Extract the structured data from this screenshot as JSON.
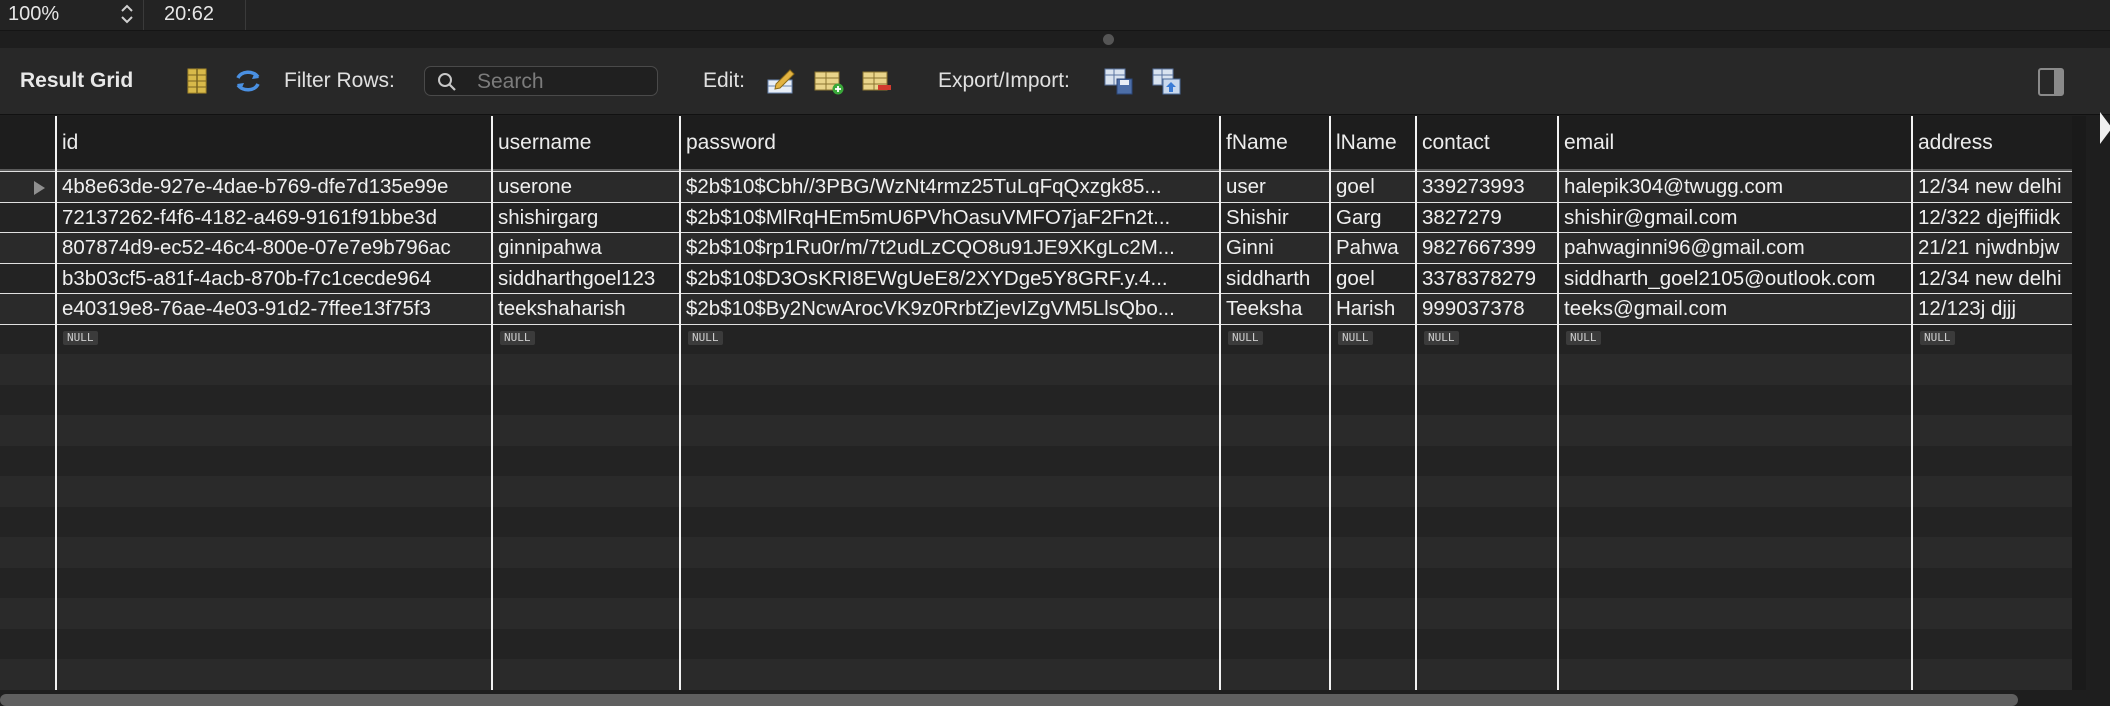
{
  "status": {
    "zoom": "100%",
    "cursor_position": "20:62"
  },
  "toolbar": {
    "result_grid": "Result Grid",
    "filter_rows": "Filter Rows:",
    "search_placeholder": "Search",
    "edit": "Edit:",
    "export_import": "Export/Import:"
  },
  "colors": {
    "background": "#1e1e1e",
    "row_odd": "#2a2a2a",
    "row_even": "#232323",
    "grid_line": "#f2f2f2"
  },
  "columns": [
    "id",
    "username",
    "password",
    "fName",
    "lName",
    "contact",
    "email",
    "address"
  ],
  "rows": [
    [
      "4b8e63de-927e-4dae-b769-dfe7d135e99e",
      "userone",
      "$2b$10$Cbh//3PBG/WzNt4rmz25TuLqFqQxzgk85...",
      "user",
      "goel",
      "339273993",
      "halepik304@twugg.com",
      "12/34 new delhi"
    ],
    [
      "72137262-f4f6-4182-a469-9161f91bbe3d",
      "shishirgarg",
      "$2b$10$MlRqHEm5mU6PVhOasuVMFO7jaF2Fn2t...",
      "Shishir",
      "Garg",
      "3827279",
      "shishir@gmail.com",
      "12/322 djejffiidk"
    ],
    [
      "807874d9-ec52-46c4-800e-07e7e9b796ac",
      "ginnipahwa",
      "$2b$10$rp1Ru0r/m/7t2udLzCQO8u91JE9XKgLc2M...",
      "Ginni",
      "Pahwa",
      "9827667399",
      "pahwaginni96@gmail.com",
      "21/21 njwdnbjw"
    ],
    [
      "b3b03cf5-a81f-4acb-870b-f7c1cecde964",
      "siddharthgoel123",
      "$2b$10$D3OsKRI8EWgUeE8/2XYDge5Y8GRF.y.4...",
      "siddharth",
      "goel",
      "3378378279",
      "siddharth_goel2105@outlook.com",
      "12/34 new delhi"
    ],
    [
      "e40319e8-76ae-4e03-91d2-7ffee13f75f3",
      "teekshaharish",
      "$2b$10$By2NcwArocVK9z0RrbtZjevIZgVM5LlsQbo...",
      "Teeksha",
      "Harish",
      "999037378",
      "teeks@gmail.com",
      "12/123j djjj"
    ]
  ],
  "null_label": "NULL"
}
